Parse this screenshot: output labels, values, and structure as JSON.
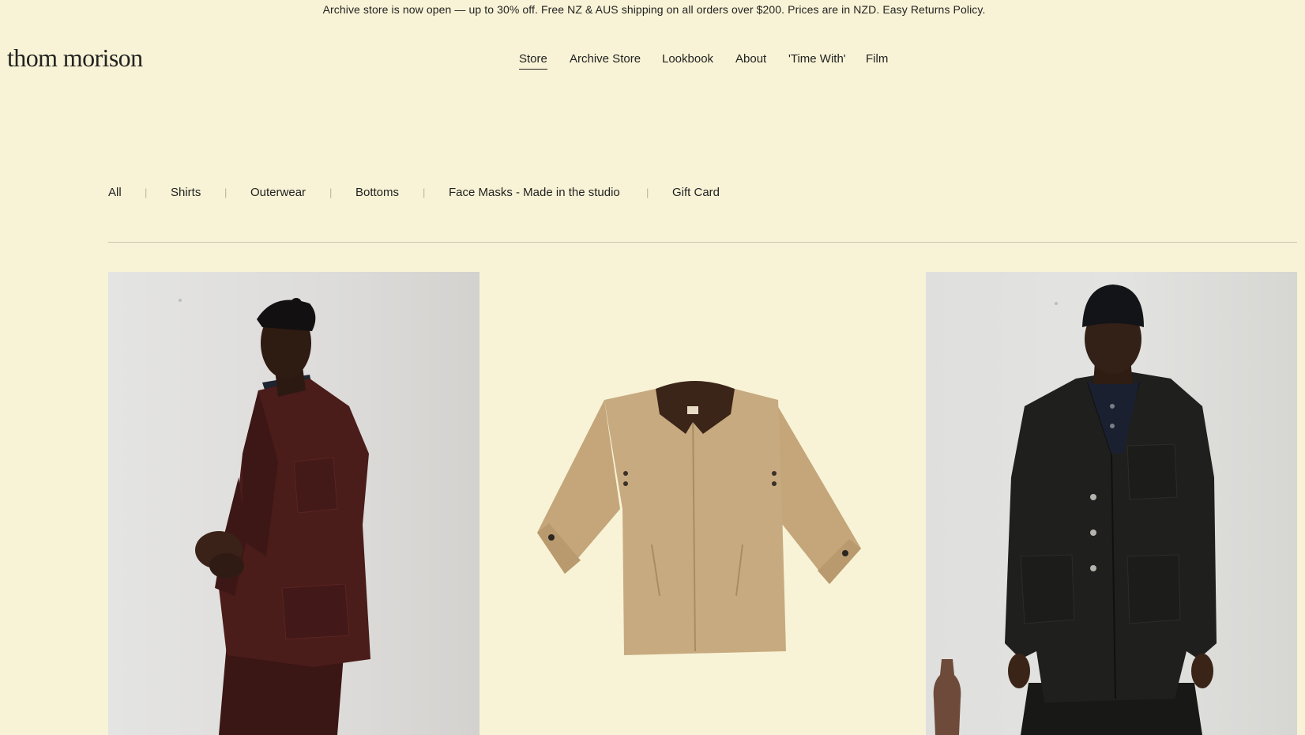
{
  "announcement": {
    "text": "Archive store is now open — up to 30% off. Free NZ & AUS shipping on all orders over $200. Prices are in NZD.",
    "returns_link": "Easy Returns Policy."
  },
  "logo": "thom morison",
  "main_nav": [
    {
      "label": "Store",
      "active": true
    },
    {
      "label": "Archive Store"
    },
    {
      "label": "Lookbook"
    },
    {
      "label": "About"
    },
    {
      "label": "'Time With'"
    },
    {
      "label": "Film"
    }
  ],
  "categories": [
    {
      "label": "All"
    },
    {
      "label": "Shirts"
    },
    {
      "label": "Outerwear"
    },
    {
      "label": "Bottoms"
    },
    {
      "label": "Face Masks - Made in the studio"
    },
    {
      "label": "Gift Card"
    }
  ],
  "separator": "|",
  "colors": {
    "background": "#f8f3d6",
    "text": "#1e1e1e",
    "rule": "#c9c5b0"
  }
}
